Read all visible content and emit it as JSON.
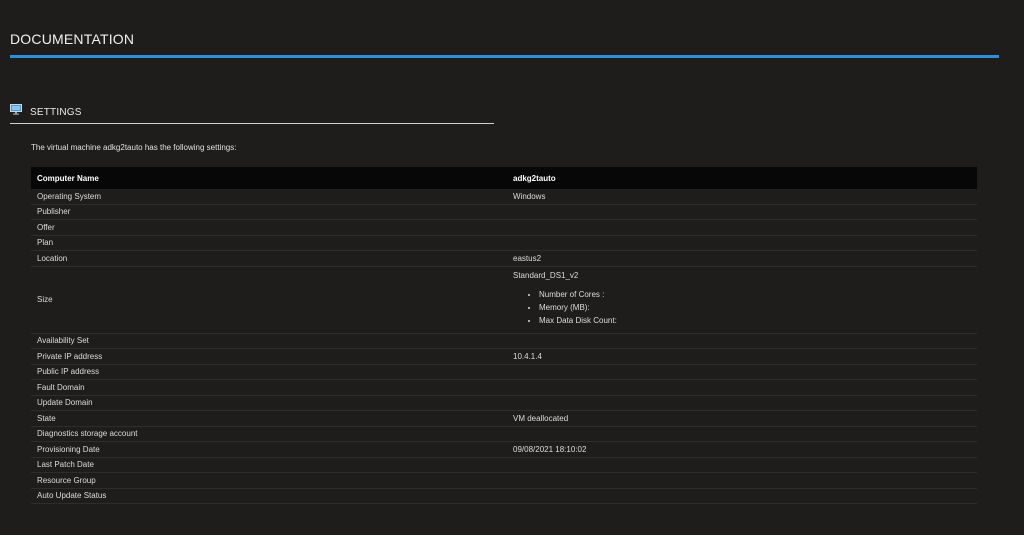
{
  "header": {
    "title": "DOCUMENTATION",
    "accent_color": "#2d8fd8"
  },
  "section": {
    "title": "SETTINGS",
    "icon": "monitor-icon",
    "intro": "The virtual machine adkg2tauto has the following settings:"
  },
  "table": {
    "header": {
      "name": "Computer Name",
      "value": "adkg2tauto"
    },
    "rows": [
      {
        "name": "Operating System",
        "value": "Windows"
      },
      {
        "name": "Publisher",
        "value": ""
      },
      {
        "name": "Offer",
        "value": ""
      },
      {
        "name": "Plan",
        "value": ""
      },
      {
        "name": "Location",
        "value": "eastus2"
      },
      {
        "name": "Size",
        "value": "Standard_DS1_v2",
        "details": [
          "Number of Cores :",
          "Memory (MB):",
          "Max Data Disk Count:"
        ]
      },
      {
        "name": "Availability Set",
        "value": ""
      },
      {
        "name": "Private IP address",
        "value": "10.4.1.4"
      },
      {
        "name": "Public IP address",
        "value": ""
      },
      {
        "name": "Fault Domain",
        "value": ""
      },
      {
        "name": "Update Domain",
        "value": ""
      },
      {
        "name": "State",
        "value": "VM deallocated"
      },
      {
        "name": "Diagnostics storage account",
        "value": ""
      },
      {
        "name": "Provisioning Date",
        "value": "09/08/2021 18:10:02"
      },
      {
        "name": "Last Patch Date",
        "value": ""
      },
      {
        "name": "Resource Group",
        "value": ""
      },
      {
        "name": "Auto Update Status",
        "value": ""
      }
    ]
  }
}
